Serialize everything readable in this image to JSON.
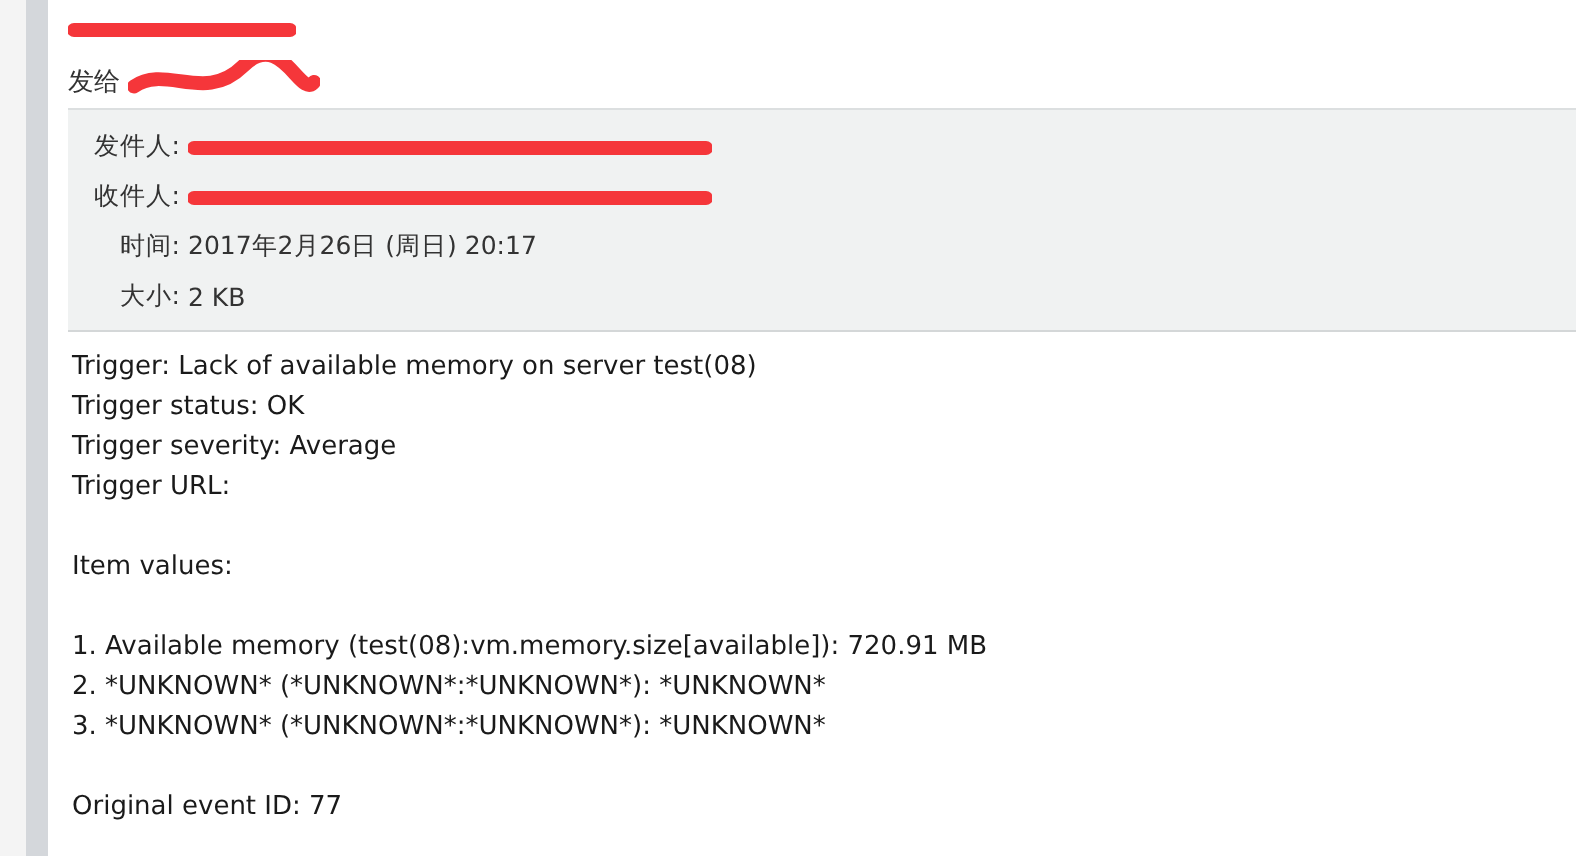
{
  "message": {
    "subject": {
      "redacted": true
    },
    "sent_to": {
      "label": "发给",
      "redacted": true
    },
    "header_fields": [
      {
        "label": "发件人:",
        "kind": "redacted"
      },
      {
        "label": "收件人:",
        "kind": "redacted"
      },
      {
        "label": "时间:",
        "kind": "text",
        "value": "2017年2月26日 (周日) 20:17"
      },
      {
        "label": "大小:",
        "kind": "text",
        "value": "2 KB"
      }
    ],
    "body": [
      [
        "Trigger: Lack of available memory on server test(08)",
        "Trigger status: OK",
        "Trigger severity: Average",
        "Trigger URL:"
      ],
      [
        "Item values:"
      ],
      [
        "1. Available memory (test(08):vm.memory.size[available]): 720.91 MB",
        "2. *UNKNOWN* (*UNKNOWN*:*UNKNOWN*): *UNKNOWN*",
        "3. *UNKNOWN* (*UNKNOWN*:*UNKNOWN*): *UNKNOWN*"
      ],
      [
        "Original event ID: 77"
      ]
    ]
  }
}
